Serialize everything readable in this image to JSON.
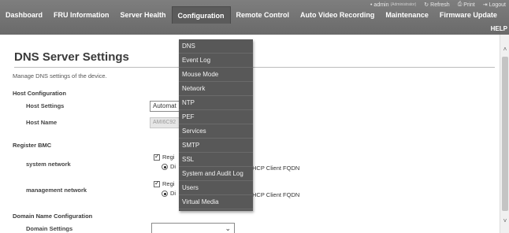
{
  "util": {
    "admin_label": "• admin",
    "admin_role": "(Administrator)",
    "refresh_label": "Refresh",
    "print_label": "Print",
    "logout_label": "Logout"
  },
  "nav": {
    "items": [
      "Dashboard",
      "FRU Information",
      "Server Health",
      "Configuration",
      "Remote Control",
      "Auto Video Recording",
      "Maintenance",
      "Firmware Update"
    ],
    "help": "HELP"
  },
  "page": {
    "title": "DNS Server Settings",
    "description": "Manage DNS settings of the device."
  },
  "host_configuration": {
    "section": "Host Configuration",
    "host_settings_label": "Host Settings",
    "host_settings_value": "Automat",
    "host_name_label": "Host Name",
    "host_name_value": "AMI6C92"
  },
  "register_bmc": {
    "section": "Register BMC",
    "system_network_label": "system network",
    "management_network_label": "management network",
    "register_label": "Regi",
    "option_prefix": "Di",
    "option_suffix": "HCP Client FQDN"
  },
  "domain": {
    "section": "Domain Name Configuration",
    "settings_label": "Domain Settings",
    "settings_value": ""
  },
  "menu": {
    "items": [
      "DNS",
      "Event Log",
      "Mouse Mode",
      "Network",
      "NTP",
      "PEF",
      "Services",
      "SMTP",
      "SSL",
      "System and Audit Log",
      "Users",
      "Virtual Media"
    ]
  },
  "colors": {
    "topbar": "#767676",
    "menu_bg": "#585858",
    "accent_text": "#ffffff"
  }
}
